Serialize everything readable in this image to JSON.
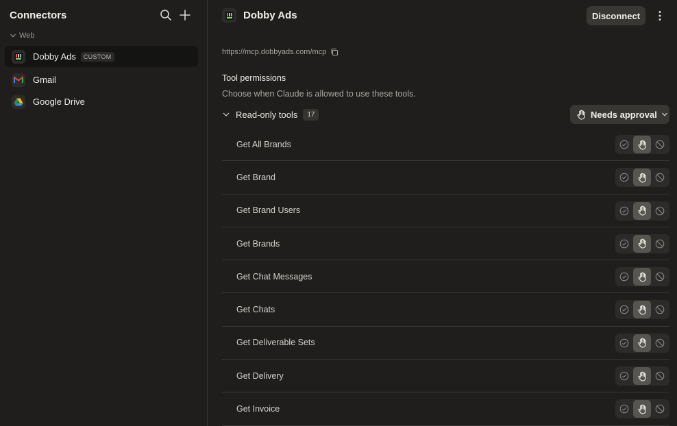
{
  "sidebar": {
    "title": "Connectors",
    "group_label": "Web",
    "items": [
      {
        "label": "Dobby Ads",
        "badge": "CUSTOM",
        "active": true
      },
      {
        "label": "Gmail",
        "badge": "",
        "active": false
      },
      {
        "label": "Google Drive",
        "badge": "",
        "active": false
      }
    ]
  },
  "header": {
    "title": "Dobby Ads",
    "disconnect_label": "Disconnect"
  },
  "url": "https://mcp.dobbyads.com/mcp",
  "permissions": {
    "title": "Tool permissions",
    "description": "Choose when Claude is allowed to use these tools.",
    "group_label": "Read-only tools",
    "group_count": "17",
    "mode_label": "Needs approval"
  },
  "tools": [
    {
      "name": "Get All Brands",
      "mode": "needs-approval"
    },
    {
      "name": "Get Brand",
      "mode": "needs-approval"
    },
    {
      "name": "Get Brand Users",
      "mode": "needs-approval"
    },
    {
      "name": "Get Brands",
      "mode": "needs-approval"
    },
    {
      "name": "Get Chat Messages",
      "mode": "needs-approval"
    },
    {
      "name": "Get Chats",
      "mode": "needs-approval"
    },
    {
      "name": "Get Deliverable Sets",
      "mode": "needs-approval"
    },
    {
      "name": "Get Delivery",
      "mode": "needs-approval"
    },
    {
      "name": "Get Invoice",
      "mode": "needs-approval"
    }
  ],
  "colors": {
    "background": "#1f1e1d",
    "active_item": "#141413",
    "selected_segment": "#56554f"
  }
}
